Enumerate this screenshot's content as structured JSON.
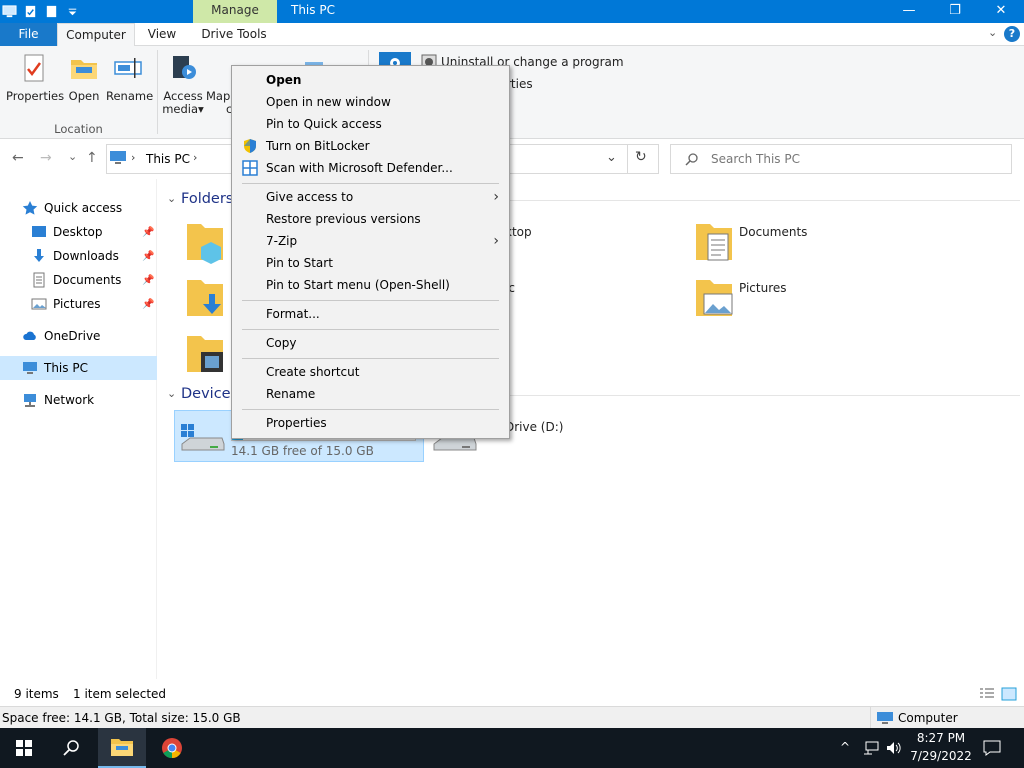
{
  "titlebar": {
    "manage_label": "Manage",
    "title": "This PC",
    "minimize": "—",
    "maximize": "❐",
    "close": "✕"
  },
  "ribbon_tabs": {
    "file": "File",
    "computer": "Computer",
    "view": "View",
    "drive_tools": "Drive Tools",
    "expand_glyph": "⌄",
    "help_glyph": "?"
  },
  "ribbon": {
    "properties": "Properties",
    "open": "Open",
    "rename": "Rename",
    "access_media_1": "Access",
    "access_media_2": "media",
    "access_media_arrow": "▾",
    "map_1": "Map",
    "map_2": "c",
    "location_group": "Location",
    "uninstall": "Uninstall or change a program",
    "system_properties_partial": "rties"
  },
  "address": {
    "back": "←",
    "forward": "→",
    "recent": "⌄",
    "up": "↑",
    "path_root": "This PC",
    "path_sep": "›",
    "dropdown": "⌄",
    "refresh": "↻",
    "search_placeholder": "Search This PC"
  },
  "nav": {
    "quick_access": "Quick access",
    "desktop": "Desktop",
    "downloads": "Downloads",
    "documents": "Documents",
    "pictures": "Pictures",
    "onedrive": "OneDrive",
    "this_pc": "This PC",
    "network": "Network",
    "pin_glyph": "📌"
  },
  "content": {
    "folders_header": "Folders",
    "devices_header": "Devices",
    "desktop_partial": "ktop",
    "documents": "Documents",
    "music_partial": "ic",
    "pictures": "Pictures",
    "drive_d_partial": "Drive (D:)",
    "drive_c_free": "14.1 GB free of 15.0 GB",
    "drive_c_fill": 0.06
  },
  "status": {
    "items": "9 items",
    "selected": "1 item selected",
    "space": "Space free: 14.1 GB, Total size: 15.0 GB",
    "computer": "Computer"
  },
  "taskbar": {
    "time": "8:27 PM",
    "date": "7/29/2022",
    "chevron": "^"
  },
  "menu": {
    "open": "Open",
    "open_new_window": "Open in new window",
    "pin_quick": "Pin to Quick access",
    "bitlocker": "Turn on BitLocker",
    "defender": "Scan with Microsoft Defender...",
    "give_access": "Give access to",
    "restore": "Restore previous versions",
    "zip": "7-Zip",
    "pin_start": "Pin to Start",
    "pin_start_shell": "Pin to Start menu (Open-Shell)",
    "format": "Format...",
    "copy": "Copy",
    "create_shortcut": "Create shortcut",
    "rename": "Rename",
    "properties": "Properties",
    "submenu_arrow": "›"
  },
  "colors": {
    "accent": "#0078d7",
    "selection": "#cce8ff",
    "taskbar": "#101820"
  }
}
